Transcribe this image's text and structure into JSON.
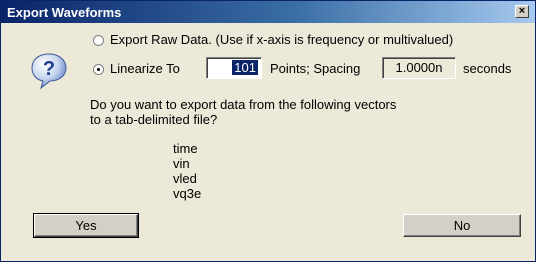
{
  "window": {
    "title": "Export Waveforms",
    "close_glyph": "×"
  },
  "icon": {
    "name": "question-icon",
    "glyph": "?"
  },
  "options": {
    "raw": {
      "label": "Export Raw Data. (Use if x-axis is frequency or multivalued)",
      "checked": false
    },
    "linearize": {
      "label_before": "Linearize To",
      "points_value": "101",
      "label_middle": "Points; Spacing",
      "spacing_value": "1.0000n",
      "label_after": "seconds",
      "checked": true
    }
  },
  "message": {
    "line1": "Do you want to export data from the following vectors",
    "line2": "to a tab-delimited file?"
  },
  "vectors": [
    "time",
    "vin",
    "vled",
    "vq3e"
  ],
  "buttons": {
    "yes": "Yes",
    "no": "No"
  },
  "colors": {
    "title_start": "#0a246a",
    "title_end": "#a6caf0",
    "dialog_bg": "#ece9d8"
  }
}
